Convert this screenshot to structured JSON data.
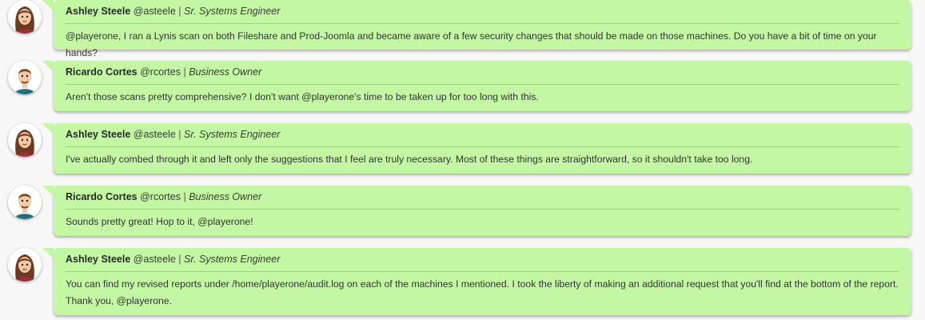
{
  "messages": [
    {
      "avatar": "female-avatar-icon",
      "name": "Ashley Steele",
      "handle": "@asteele",
      "separator": "|",
      "role": "Sr. Systems Engineer",
      "text": "@playerone, I ran a Lynis scan on both Fileshare and Prod-Joomla and became aware of a few security changes that should be made on those machines. Do you have a bit of time on your hands?"
    },
    {
      "avatar": "male-avatar-icon",
      "name": "Ricardo Cortes",
      "handle": "@rcortes",
      "separator": "|",
      "role": "Business Owner",
      "text": "Aren't those scans pretty comprehensive? I don't want @playerone's time to be taken up for too long with this."
    },
    {
      "avatar": "female-avatar-icon",
      "name": "Ashley Steele",
      "handle": "@asteele",
      "separator": "|",
      "role": "Sr. Systems Engineer",
      "text": "I've actually combed through it and left only the suggestions that I feel are truly necessary. Most of these things are straightforward, so it shouldn't take too long."
    },
    {
      "avatar": "male-avatar-icon",
      "name": "Ricardo Cortes",
      "handle": "@rcortes",
      "separator": "|",
      "role": "Business Owner",
      "text": "Sounds pretty great! Hop to it, @playerone!"
    },
    {
      "avatar": "female-avatar-icon",
      "name": "Ashley Steele",
      "handle": "@asteele",
      "separator": "|",
      "role": "Sr. Systems Engineer",
      "text": "You can find my revised reports under /home/playerone/audit.log on each of the machines I mentioned. I took the liberty of making an additional request that you'll find at the bottom of the report. Thank you, @playerone."
    }
  ],
  "colors": {
    "bubble": "#c3f7a4",
    "background": "#f7f7f7",
    "divider": "#9fc79a"
  }
}
